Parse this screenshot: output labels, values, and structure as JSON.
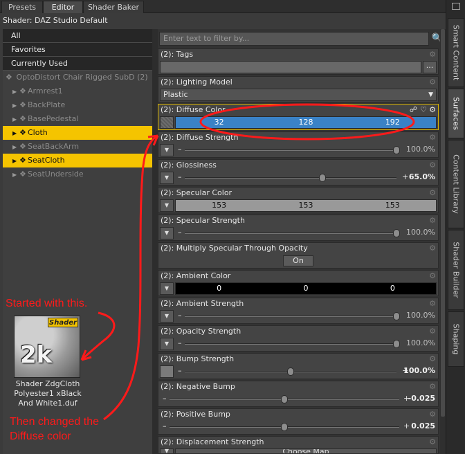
{
  "tabs": [
    "Presets",
    "Editor",
    "Shader Baker"
  ],
  "shader_label": "Shader: DAZ Studio Default",
  "categories": [
    "All",
    "Favorites",
    "Currently Used"
  ],
  "tree": {
    "root": "OptoDistort Chair Rigged SubD (2)",
    "items": [
      {
        "label": "Armrest1",
        "selected": false
      },
      {
        "label": "BackPlate",
        "selected": false
      },
      {
        "label": "BasePedestal",
        "selected": false
      },
      {
        "label": "Cloth",
        "selected": true
      },
      {
        "label": "SeatBackArm",
        "selected": false
      },
      {
        "label": "SeatCloth",
        "selected": true
      },
      {
        "label": "SeatUnderside",
        "selected": false
      }
    ]
  },
  "filter_placeholder": "Enter text to filter by...",
  "properties": {
    "tags": {
      "label": "(2): Tags",
      "button": "..."
    },
    "lighting_model": {
      "label": "(2): Lighting Model",
      "value": "Plastic"
    },
    "diffuse_color": {
      "label": "(2): Diffuse Color",
      "r": "32",
      "g": "128",
      "b": "192",
      "color": "#3a82c6"
    },
    "diffuse_strength": {
      "label": "(2): Diffuse Strength",
      "value": "100.0%",
      "fraction": 1.0
    },
    "glossiness": {
      "label": "(2): Glossiness",
      "value": "65.0%",
      "fraction": 0.65
    },
    "specular_color": {
      "label": "(2): Specular Color",
      "r": "153",
      "g": "153",
      "b": "153",
      "color": "#999999"
    },
    "specular_strength": {
      "label": "(2): Specular Strength",
      "value": "100.0%",
      "fraction": 1.0
    },
    "multiply_specular": {
      "label": "(2): Multiply Specular Through Opacity",
      "value": "On"
    },
    "ambient_color": {
      "label": "(2): Ambient Color",
      "r": "0",
      "g": "0",
      "b": "0",
      "color": "#000000"
    },
    "ambient_strength": {
      "label": "(2): Ambient Strength",
      "value": "100.0%",
      "fraction": 1.0
    },
    "opacity_strength": {
      "label": "(2): Opacity Strength",
      "value": "100.0%",
      "fraction": 1.0
    },
    "bump_strength": {
      "label": "(2): Bump Strength",
      "value": "100.0%",
      "fraction": 0.5
    },
    "negative_bump": {
      "label": "(2): Negative Bump",
      "value": "-0.025",
      "fraction": 0.5
    },
    "positive_bump": {
      "label": "(2): Positive Bump",
      "value": "0.025",
      "fraction": 0.5
    },
    "displacement_strength": {
      "label": "(2): Displacement Strength",
      "button": "Choose Map"
    }
  },
  "side_tabs": [
    "Smart Content",
    "Surfaces",
    "Content Library",
    "Shader Builder",
    "Shaping"
  ],
  "thumbnail": {
    "badge": "Shader",
    "big_text": "2k",
    "caption": "Shader ZdgCloth Polyester1 xBlack And White1.duf"
  },
  "annotations": {
    "started": "Started with this.",
    "changed_line1": "Then changed the",
    "changed_line2": "Diffuse color"
  },
  "icons": {
    "search": "search-icon",
    "gear": "gear-icon",
    "link": "link-icon",
    "heart": "heart-icon",
    "dropdown": "chevron-down-icon"
  }
}
